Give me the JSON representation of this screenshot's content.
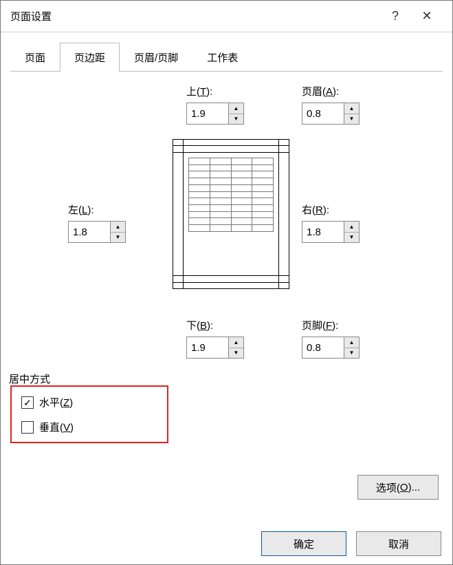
{
  "dialog": {
    "title": "页面设置",
    "help": "?",
    "close": "✕"
  },
  "tabs": {
    "page": "页面",
    "margins": "页边距",
    "header_footer": "页眉/页脚",
    "sheet": "工作表",
    "active": "margins"
  },
  "margins": {
    "top_prefix": "上(",
    "top_u": "T",
    "top_suffix": "):",
    "top_value": "1.9",
    "bottom_prefix": "下(",
    "bottom_u": "B",
    "bottom_suffix": "):",
    "bottom_value": "1.9",
    "left_prefix": "左(",
    "left_u": "L",
    "left_suffix": "):",
    "left_value": "1.8",
    "right_prefix": "右(",
    "right_u": "R",
    "right_suffix": "):",
    "right_value": "1.8",
    "header_prefix": "页眉(",
    "header_u": "A",
    "header_suffix": "):",
    "header_value": "0.8",
    "footer_prefix": "页脚(",
    "footer_u": "F",
    "footer_suffix": "):",
    "footer_value": "0.8"
  },
  "center": {
    "legend": "居中方式",
    "horiz_prefix": "水平(",
    "horiz_u": "Z",
    "horiz_suffix": ")",
    "horiz_checked": true,
    "vert_prefix": "垂直(",
    "vert_u": "V",
    "vert_suffix": ")",
    "vert_checked": false
  },
  "buttons": {
    "options_prefix": "选项(",
    "options_u": "O",
    "options_suffix": ")...",
    "ok": "确定",
    "cancel": "取消"
  }
}
